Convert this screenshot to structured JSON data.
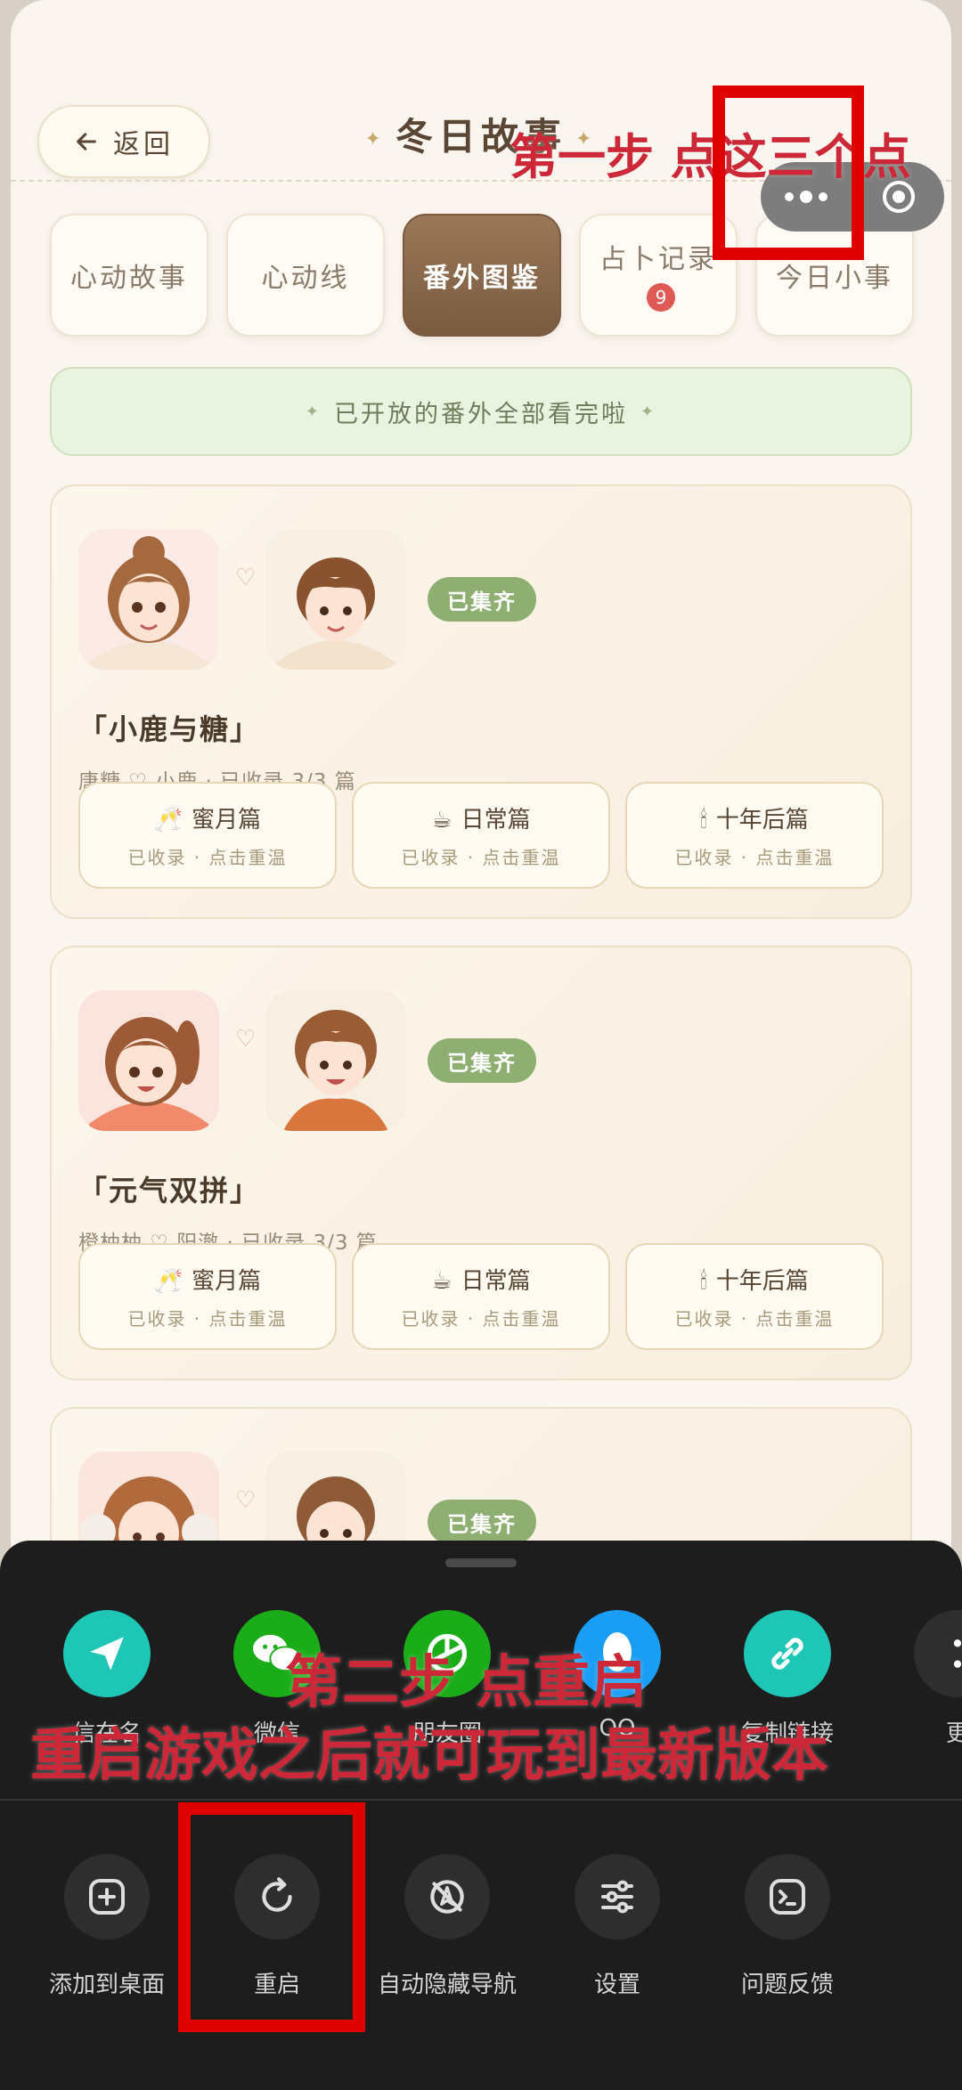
{
  "header": {
    "back_label": "返回",
    "title": "冬日故事"
  },
  "tabs": [
    {
      "label": "心动故事"
    },
    {
      "label": "心动线"
    },
    {
      "label": "番外图鉴"
    },
    {
      "label": "占卜记录",
      "badge": "9"
    },
    {
      "label": "今日小事"
    }
  ],
  "banner": {
    "text": "已开放的番外全部看完啦",
    "star": "✦"
  },
  "cards": [
    {
      "status": "已集齐",
      "title": "「小鹿与糖」",
      "meta": "唐糖 ♡ 小鹿 · 已收录 3/3 篇",
      "episodes": [
        {
          "icon": "🥂",
          "name": "蜜月篇",
          "status": "已收录 · 点击重温"
        },
        {
          "icon": "☕",
          "name": "日常篇",
          "status": "已收录 · 点击重温"
        },
        {
          "icon": "🕯",
          "name": "十年后篇",
          "status": "已收录 · 点击重温"
        }
      ]
    },
    {
      "status": "已集齐",
      "title": "「元气双拼」",
      "meta": "橙柚柚 ♡ 阳澈 · 已收录 3/3 篇",
      "episodes": [
        {
          "icon": "🥂",
          "name": "蜜月篇",
          "status": "已收录 · 点击重温"
        },
        {
          "icon": "☕",
          "name": "日常篇",
          "status": "已收录 · 点击重温"
        },
        {
          "icon": "🕯",
          "name": "十年后篇",
          "status": "已收录 · 点击重温"
        }
      ]
    },
    {
      "status": "已集齐"
    }
  ],
  "share_items": [
    {
      "label": "信在名",
      "icon": "paper-plane-icon",
      "color": "#1ec6b6"
    },
    {
      "label": "微信",
      "icon": "wechat-icon",
      "color": "#1aad19"
    },
    {
      "label": "朋友圈",
      "icon": "moments-icon",
      "color": "#1aad19"
    },
    {
      "label": "QQ",
      "icon": "qq-icon",
      "color": "#1a9df5"
    },
    {
      "label": "复制链接",
      "icon": "link-icon",
      "color": "#1ec6b6"
    },
    {
      "label": "更",
      "icon": "more-icon",
      "color": "#2e2e2e"
    }
  ],
  "actions": [
    {
      "label": "添加到桌面",
      "icon": "add-to-desktop-icon"
    },
    {
      "label": "重启",
      "icon": "restart-icon"
    },
    {
      "label": "自动隐藏导航",
      "icon": "hide-navigation-icon"
    },
    {
      "label": "设置",
      "icon": "settings-icon"
    },
    {
      "label": "问题反馈",
      "icon": "feedback-icon"
    }
  ],
  "annotations": {
    "step1": "第一步 点这三个点",
    "step2": "第二步 点重启",
    "step2_note": "重启游戏之后就可玩到最新版本"
  },
  "colors": {
    "accent": "#7a5b40",
    "annotation": "#cc2838",
    "highlight_box": "#e00000"
  }
}
